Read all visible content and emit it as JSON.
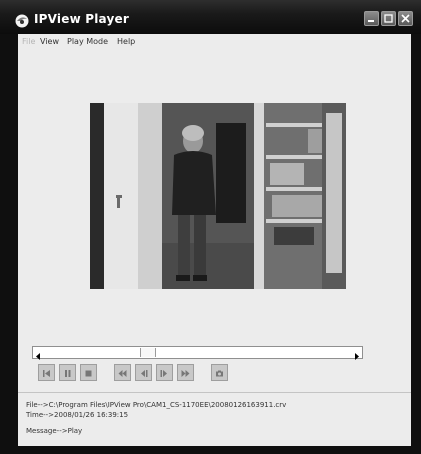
{
  "window": {
    "title": "IPView Player",
    "icon": "ipview-app-icon",
    "controls": [
      "minimize-icon",
      "maximize-icon",
      "close-icon"
    ]
  },
  "menu": {
    "items": [
      {
        "label": "File",
        "enabled": false
      },
      {
        "label": "View",
        "enabled": true
      },
      {
        "label": "Play Mode",
        "enabled": true
      },
      {
        "label": "Help",
        "enabled": true
      }
    ]
  },
  "video": {
    "description_icon": "camera-frame-image"
  },
  "timeline": {
    "position_fraction": 0.33
  },
  "toolbar": {
    "buttons": [
      {
        "icon": "step-back-icon"
      },
      {
        "icon": "pause-icon"
      },
      {
        "icon": "stop-icon"
      },
      {
        "icon": "rewind-icon"
      },
      {
        "icon": "slow-back-icon"
      },
      {
        "icon": "slow-forward-icon"
      },
      {
        "icon": "fast-forward-icon"
      },
      {
        "icon": "snapshot-icon"
      }
    ]
  },
  "status": {
    "file_line": "File-->C:\\Program Files\\IPView Pro\\CAM1_CS-1170EE\\20080126163911.crv",
    "time_line": "Time-->2008/01/26 16:39:15",
    "message_line": "Message-->Play"
  },
  "colors": {
    "titlebar": "#1a1a1a",
    "client": "#ececec",
    "button_face": "#c8c8c8"
  }
}
